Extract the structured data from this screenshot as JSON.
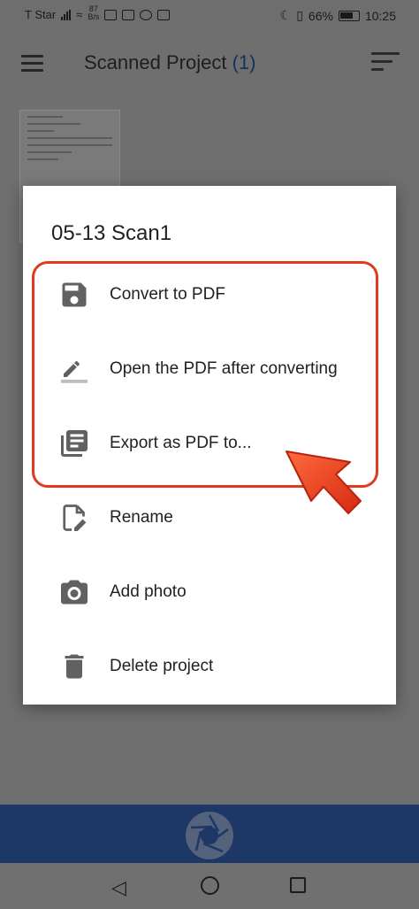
{
  "status_bar": {
    "carrier": "T Star",
    "net_speed_value": "87",
    "net_speed_unit": "B/s",
    "battery": "66%",
    "time": "10:25"
  },
  "app_bar": {
    "title": "Scanned Project",
    "count": "(1)"
  },
  "dialog": {
    "title": "05-13 Scan1",
    "items": [
      {
        "label": "Convert to PDF",
        "icon": "save-icon"
      },
      {
        "label": "Open the PDF after converting",
        "icon": "edit-pencil-icon"
      },
      {
        "label": "Export as PDF to...",
        "icon": "library-books-icon"
      },
      {
        "label": "Rename",
        "icon": "rename-document-icon"
      },
      {
        "label": "Add photo",
        "icon": "camera-icon"
      },
      {
        "label": "Delete project",
        "icon": "trash-icon"
      }
    ]
  },
  "colors": {
    "highlight": "#e03a1f",
    "bottom_bar": "#1d3766",
    "icon": "#616161"
  }
}
